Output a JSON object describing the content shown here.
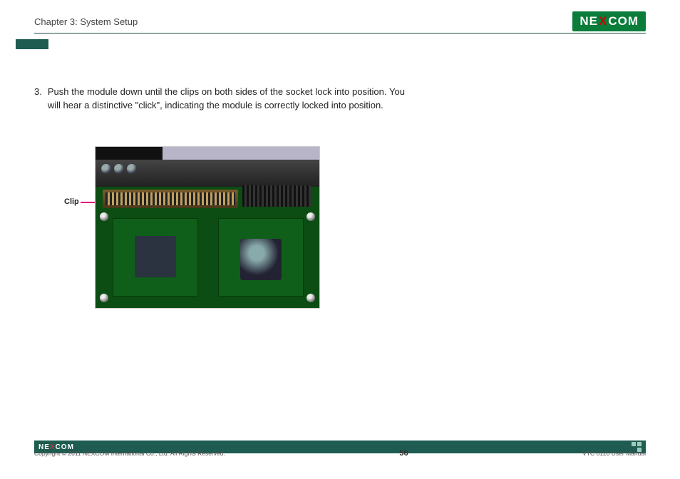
{
  "header": {
    "chapter": "Chapter 3: System Setup",
    "brand_left": "NE",
    "brand_x": "X",
    "brand_right": "COM"
  },
  "content": {
    "step_number": "3.",
    "step_text": "Push the module down until the clips on both sides of the socket lock into position. You will hear a distinctive \"click\", indicating the module is correctly locked into position."
  },
  "figure": {
    "callout": "Clip"
  },
  "footer": {
    "brand_left": "NE",
    "brand_x": "X",
    "brand_right": "COM",
    "copyright": "Copyright © 2011 NEXCOM International Co., Ltd. All Rights Reserved.",
    "page": "56",
    "doc": "VTC 6120 User Manual"
  }
}
